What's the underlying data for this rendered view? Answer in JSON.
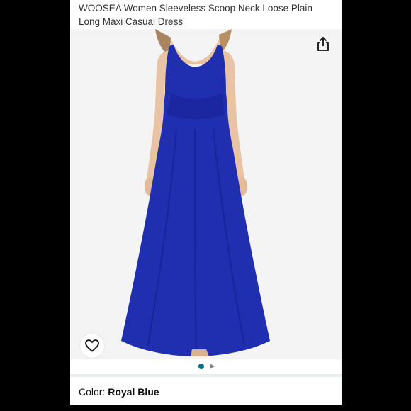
{
  "product": {
    "title": "WOOSEA Women Sleeveless Scoop Neck Loose Plain Long Maxi Casual Dress",
    "image_alt": "Royal blue sleeveless maxi dress",
    "dress_color": "#1f2fb0"
  },
  "actions": {
    "share_icon": "share-icon",
    "wishlist_icon": "heart-icon"
  },
  "gallery": {
    "active_index": 0,
    "items": [
      "image",
      "video"
    ]
  },
  "variant": {
    "label": "Color: ",
    "value": "Royal Blue"
  },
  "colors": {
    "accent_dot": "#007185",
    "background": "#000000"
  }
}
